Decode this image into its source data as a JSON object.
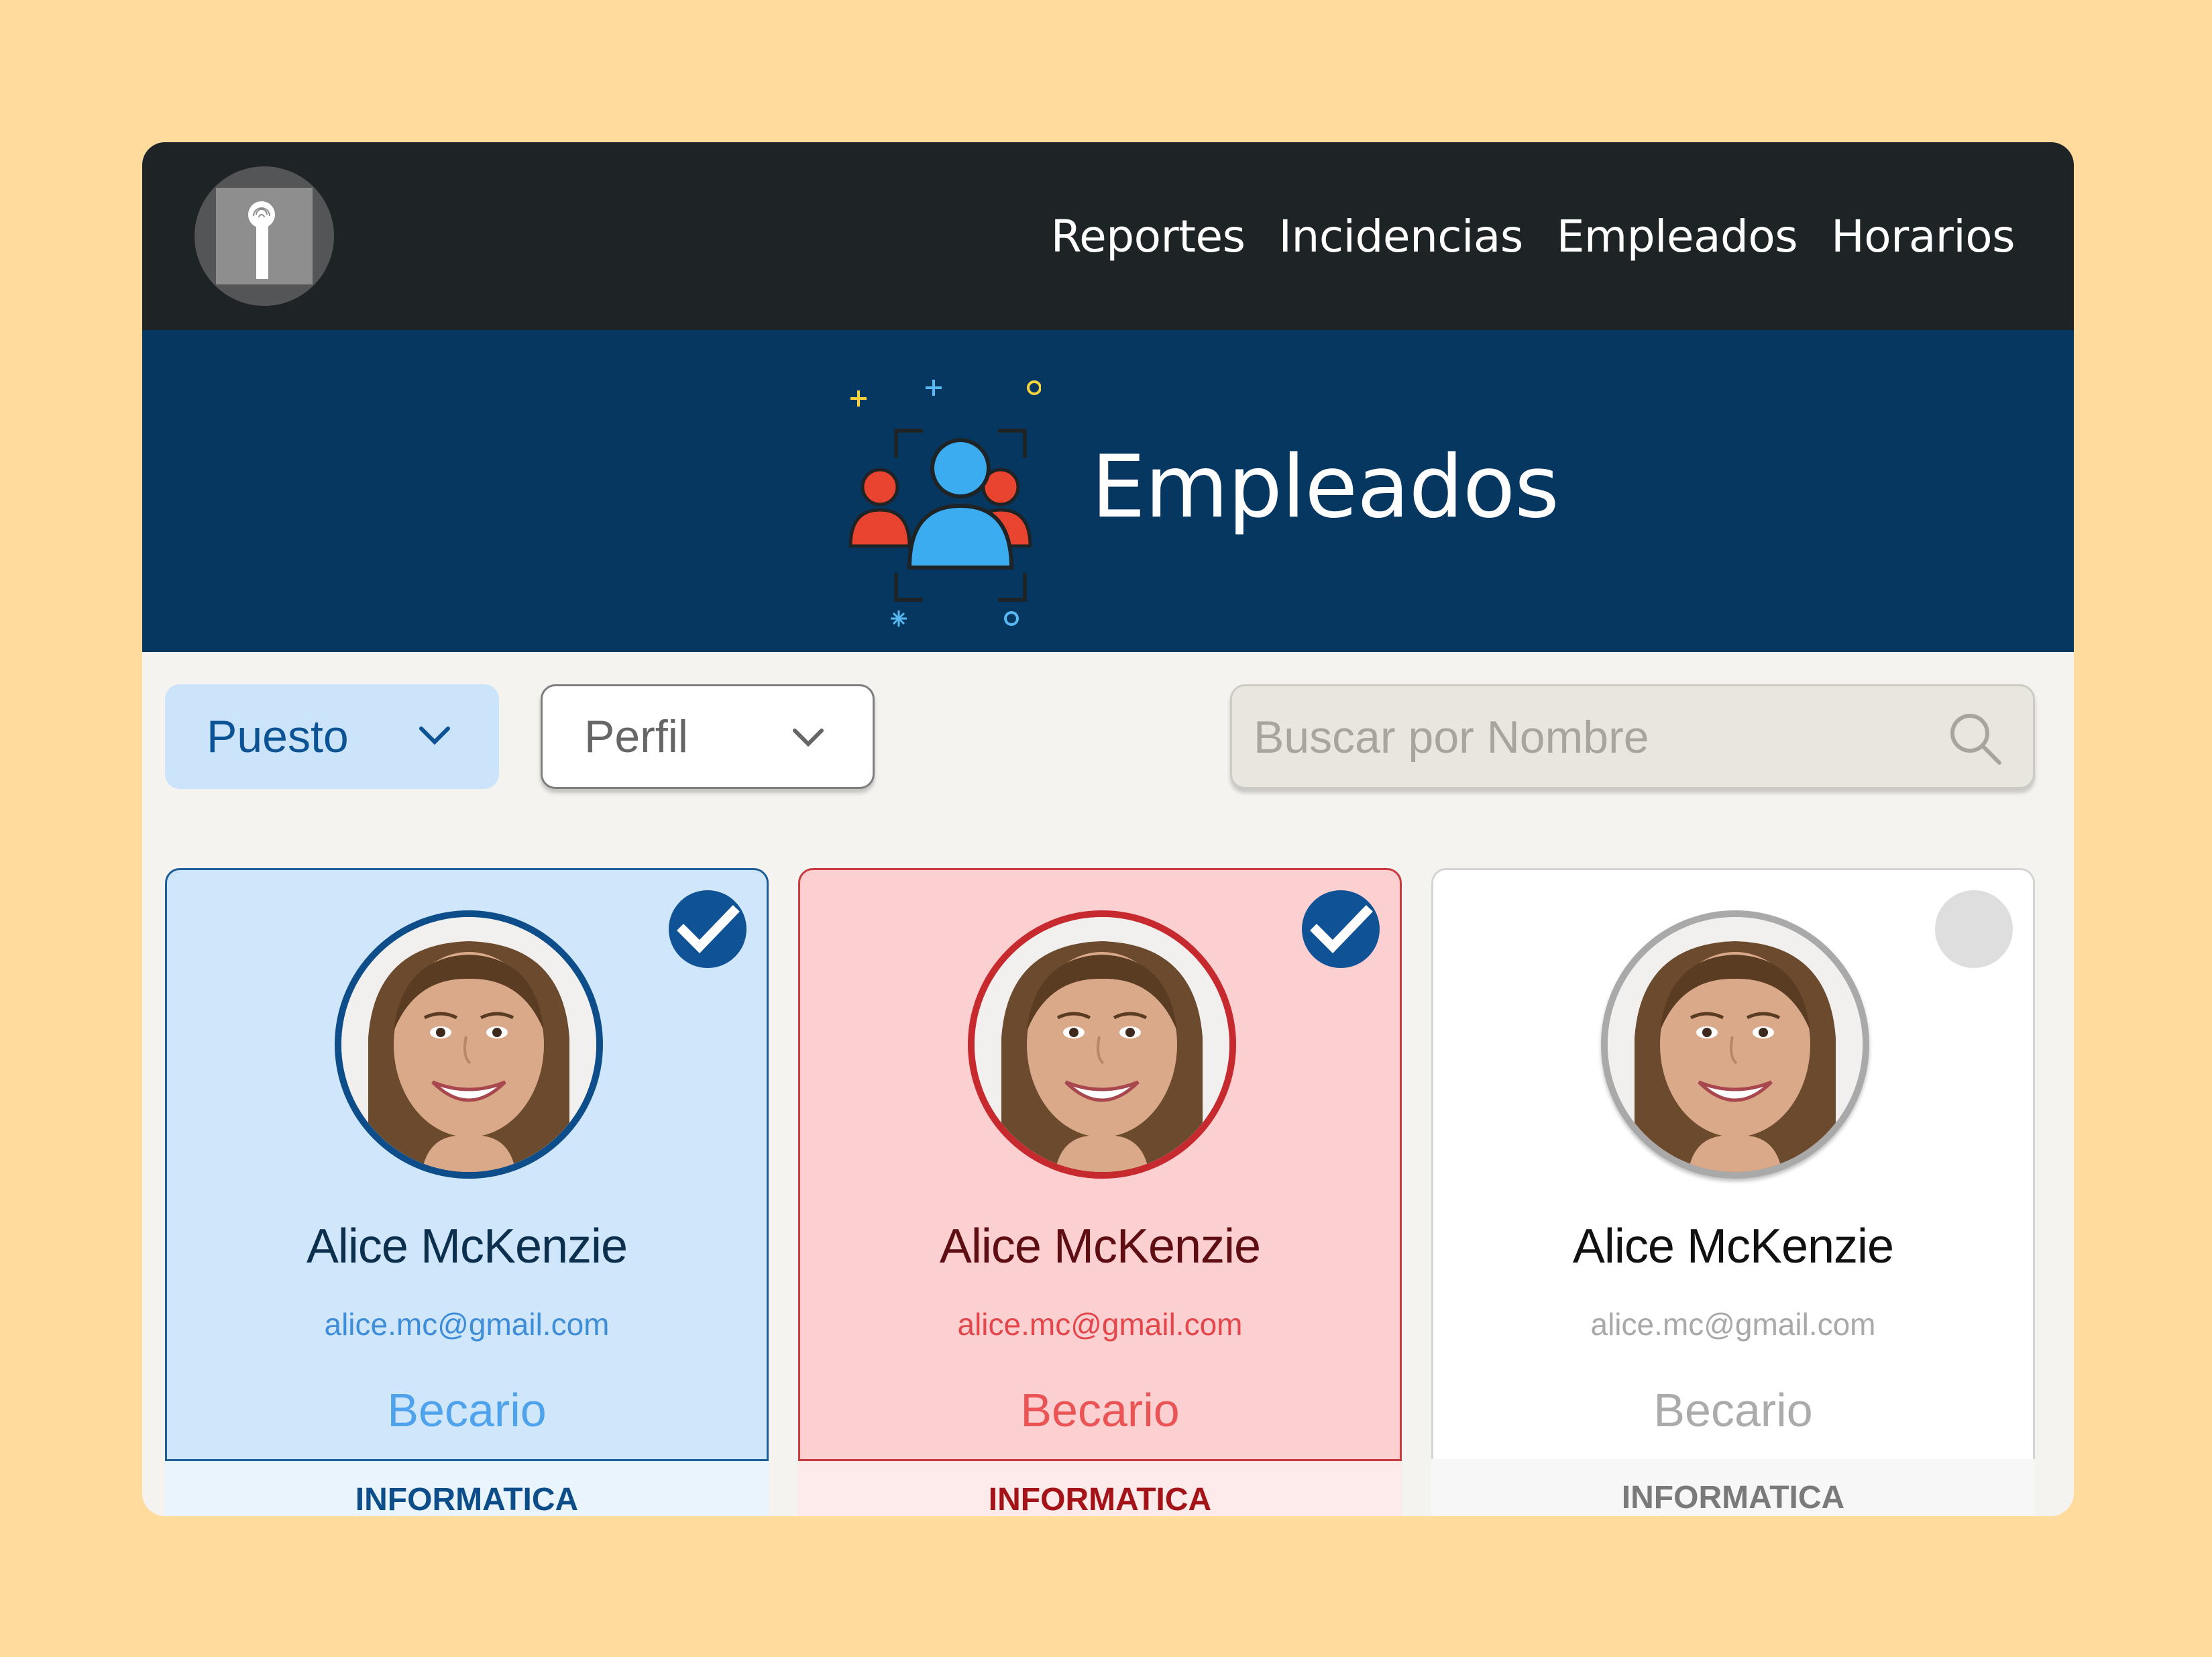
{
  "nav": {
    "items": [
      "Reportes",
      "Incidencias",
      "Empleados",
      "Horarios"
    ]
  },
  "hero": {
    "title": "Empleados",
    "illustration_icon": "employees-group-icon"
  },
  "filters": {
    "puesto": "Puesto",
    "perfil": "Perfil",
    "search_placeholder": "Buscar por Nombre"
  },
  "employees": [
    {
      "name": "Alice McKenzie",
      "email": "alice.mc@gmail.com",
      "role": "Becario",
      "department": "INFORMATICA",
      "selected": true,
      "accent": "#0D4E8A"
    },
    {
      "name": "Alice McKenzie",
      "email": "alice.mc@gmail.com",
      "role": "Becario",
      "department": "INFORMATICA",
      "selected": true,
      "accent": "#C6292E"
    },
    {
      "name": "Alice McKenzie",
      "email": "alice.mc@gmail.com",
      "role": "Becario",
      "department": "INFORMATICA",
      "selected": false,
      "accent": "#A9A9A9"
    }
  ],
  "colors": {
    "background": "#FFDC9E",
    "topbar": "#1E2326",
    "hero": "#063761",
    "selected_check": "#0F5296"
  }
}
